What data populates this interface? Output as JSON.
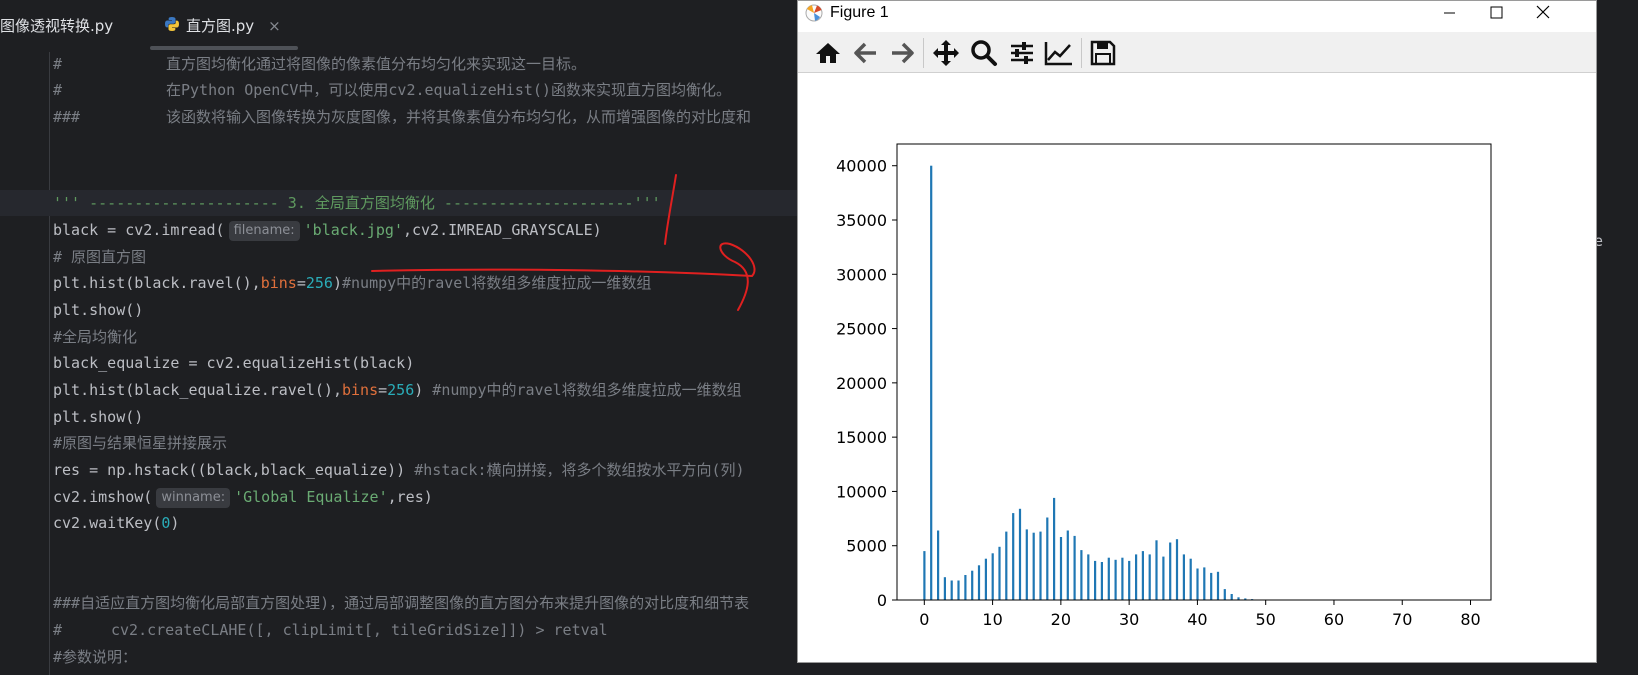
{
  "tabs": [
    {
      "label": "图像透视转换.py",
      "active": false
    },
    {
      "label": "直方图.py",
      "active": true,
      "close": "×"
    }
  ],
  "code": {
    "line0": {
      "hash": "#",
      "text": "直方图均衡化通过将图像的像素值分布均匀化来实现这一目标。"
    },
    "line1": {
      "hash": "#",
      "text": "在Python OpenCV中，可以使用cv2.equalizeHist()函数来实现直方图均衡化。"
    },
    "line2": {
      "hash": "###",
      "text": "该函数将输入图像转换为灰度图像，并将其像素值分布均匀化，从而增强图像的对比度和"
    },
    "line3": {
      "doc": "''' --------------------- 3. 全局直方图均衡化 ---------------------'''"
    },
    "line4": {
      "pre": "black = cv2.imread(",
      "hint": "filename:",
      "str": "'black.jpg'",
      "post": ",cv2.IMREAD_GRAYSCALE)"
    },
    "line5": {
      "comment": "# 原图直方图"
    },
    "line6": {
      "pre": "plt.hist(black.ravel(),",
      "kw": "bins",
      "eq": "=",
      "num": "256",
      "post": ")",
      "comment": "#numpy中的ravel将数组多维度拉成一维数组"
    },
    "line7": {
      "text": "plt.show()"
    },
    "line8": {
      "comment": "#全局均衡化"
    },
    "line9": {
      "text": "black_equalize = cv2.equalizeHist(black)"
    },
    "line10": {
      "pre": "plt.hist(black_equalize.ravel(),",
      "kw": "bins",
      "eq": "=",
      "num": "256",
      "post": ") ",
      "comment": "#numpy中的ravel将数组多维度拉成一维数组"
    },
    "line11": {
      "text": "plt.show()"
    },
    "line12": {
      "comment": "#原图与结果恒星拼接展示"
    },
    "line13": {
      "pre": "res = np.hstack((black,black_equalize)) ",
      "comment": "#hstack:横向拼接，将多个数组按水平方向(列)"
    },
    "line14": {
      "pre": "cv2.imshow(",
      "hint": "winname:",
      "str": "'Global Equalize'",
      "post": ",res)"
    },
    "line15": {
      "pre": "cv2.waitKey(",
      "num": "0",
      "post": ")"
    },
    "line16": {
      "comment": "###自适应直方图均衡化局部直方图处理)，通过局部调整图像的直方图分布来提升图像的对比度和细节表"
    },
    "line17": {
      "hash": "#",
      "text": "cv2.createCLAHE([, clipLimit[, tileGridSize]]) > retval"
    },
    "line18": {
      "comment": "#参数说明："
    }
  },
  "right_edge_text": "e",
  "figure": {
    "title": "Figure 1",
    "toolbar": [
      "home-icon",
      "back-icon",
      "forward-icon",
      "pan-icon",
      "zoom-icon",
      "configure-subplots-icon",
      "edit-axes-icon",
      "save-icon"
    ]
  },
  "chart_data": {
    "type": "bar",
    "title": "",
    "xlabel": "",
    "ylabel": "",
    "xlim": [
      -4,
      83
    ],
    "ylim": [
      0,
      42000
    ],
    "xticks": [
      0,
      10,
      20,
      30,
      40,
      50,
      60,
      70,
      80
    ],
    "yticks": [
      0,
      5000,
      10000,
      15000,
      20000,
      25000,
      30000,
      35000,
      40000
    ],
    "bar_color": "#1f77b4",
    "grid": false,
    "x": [
      0,
      1,
      2,
      3,
      4,
      5,
      6,
      7,
      8,
      9,
      10,
      11,
      12,
      13,
      14,
      15,
      16,
      17,
      18,
      19,
      20,
      21,
      22,
      23,
      24,
      25,
      26,
      27,
      28,
      29,
      30,
      31,
      32,
      33,
      34,
      35,
      36,
      37,
      38,
      39,
      40,
      41,
      42,
      43,
      44,
      45,
      46,
      47,
      48,
      49
    ],
    "values": [
      4500,
      40000,
      6400,
      2100,
      1800,
      1800,
      2300,
      2700,
      3200,
      3800,
      4300,
      4900,
      6300,
      8000,
      8400,
      6500,
      6200,
      6300,
      7600,
      9400,
      5800,
      6400,
      5900,
      4600,
      4200,
      3600,
      3500,
      3900,
      3700,
      3900,
      3600,
      4200,
      4500,
      4200,
      5500,
      4000,
      5300,
      5600,
      4200,
      3800,
      2900,
      3000,
      2500,
      2600,
      1000,
      550,
      250,
      150,
      80,
      40
    ]
  },
  "colors": {
    "ide_bg": "#1e1f22",
    "annotation_red": "#e02020"
  }
}
